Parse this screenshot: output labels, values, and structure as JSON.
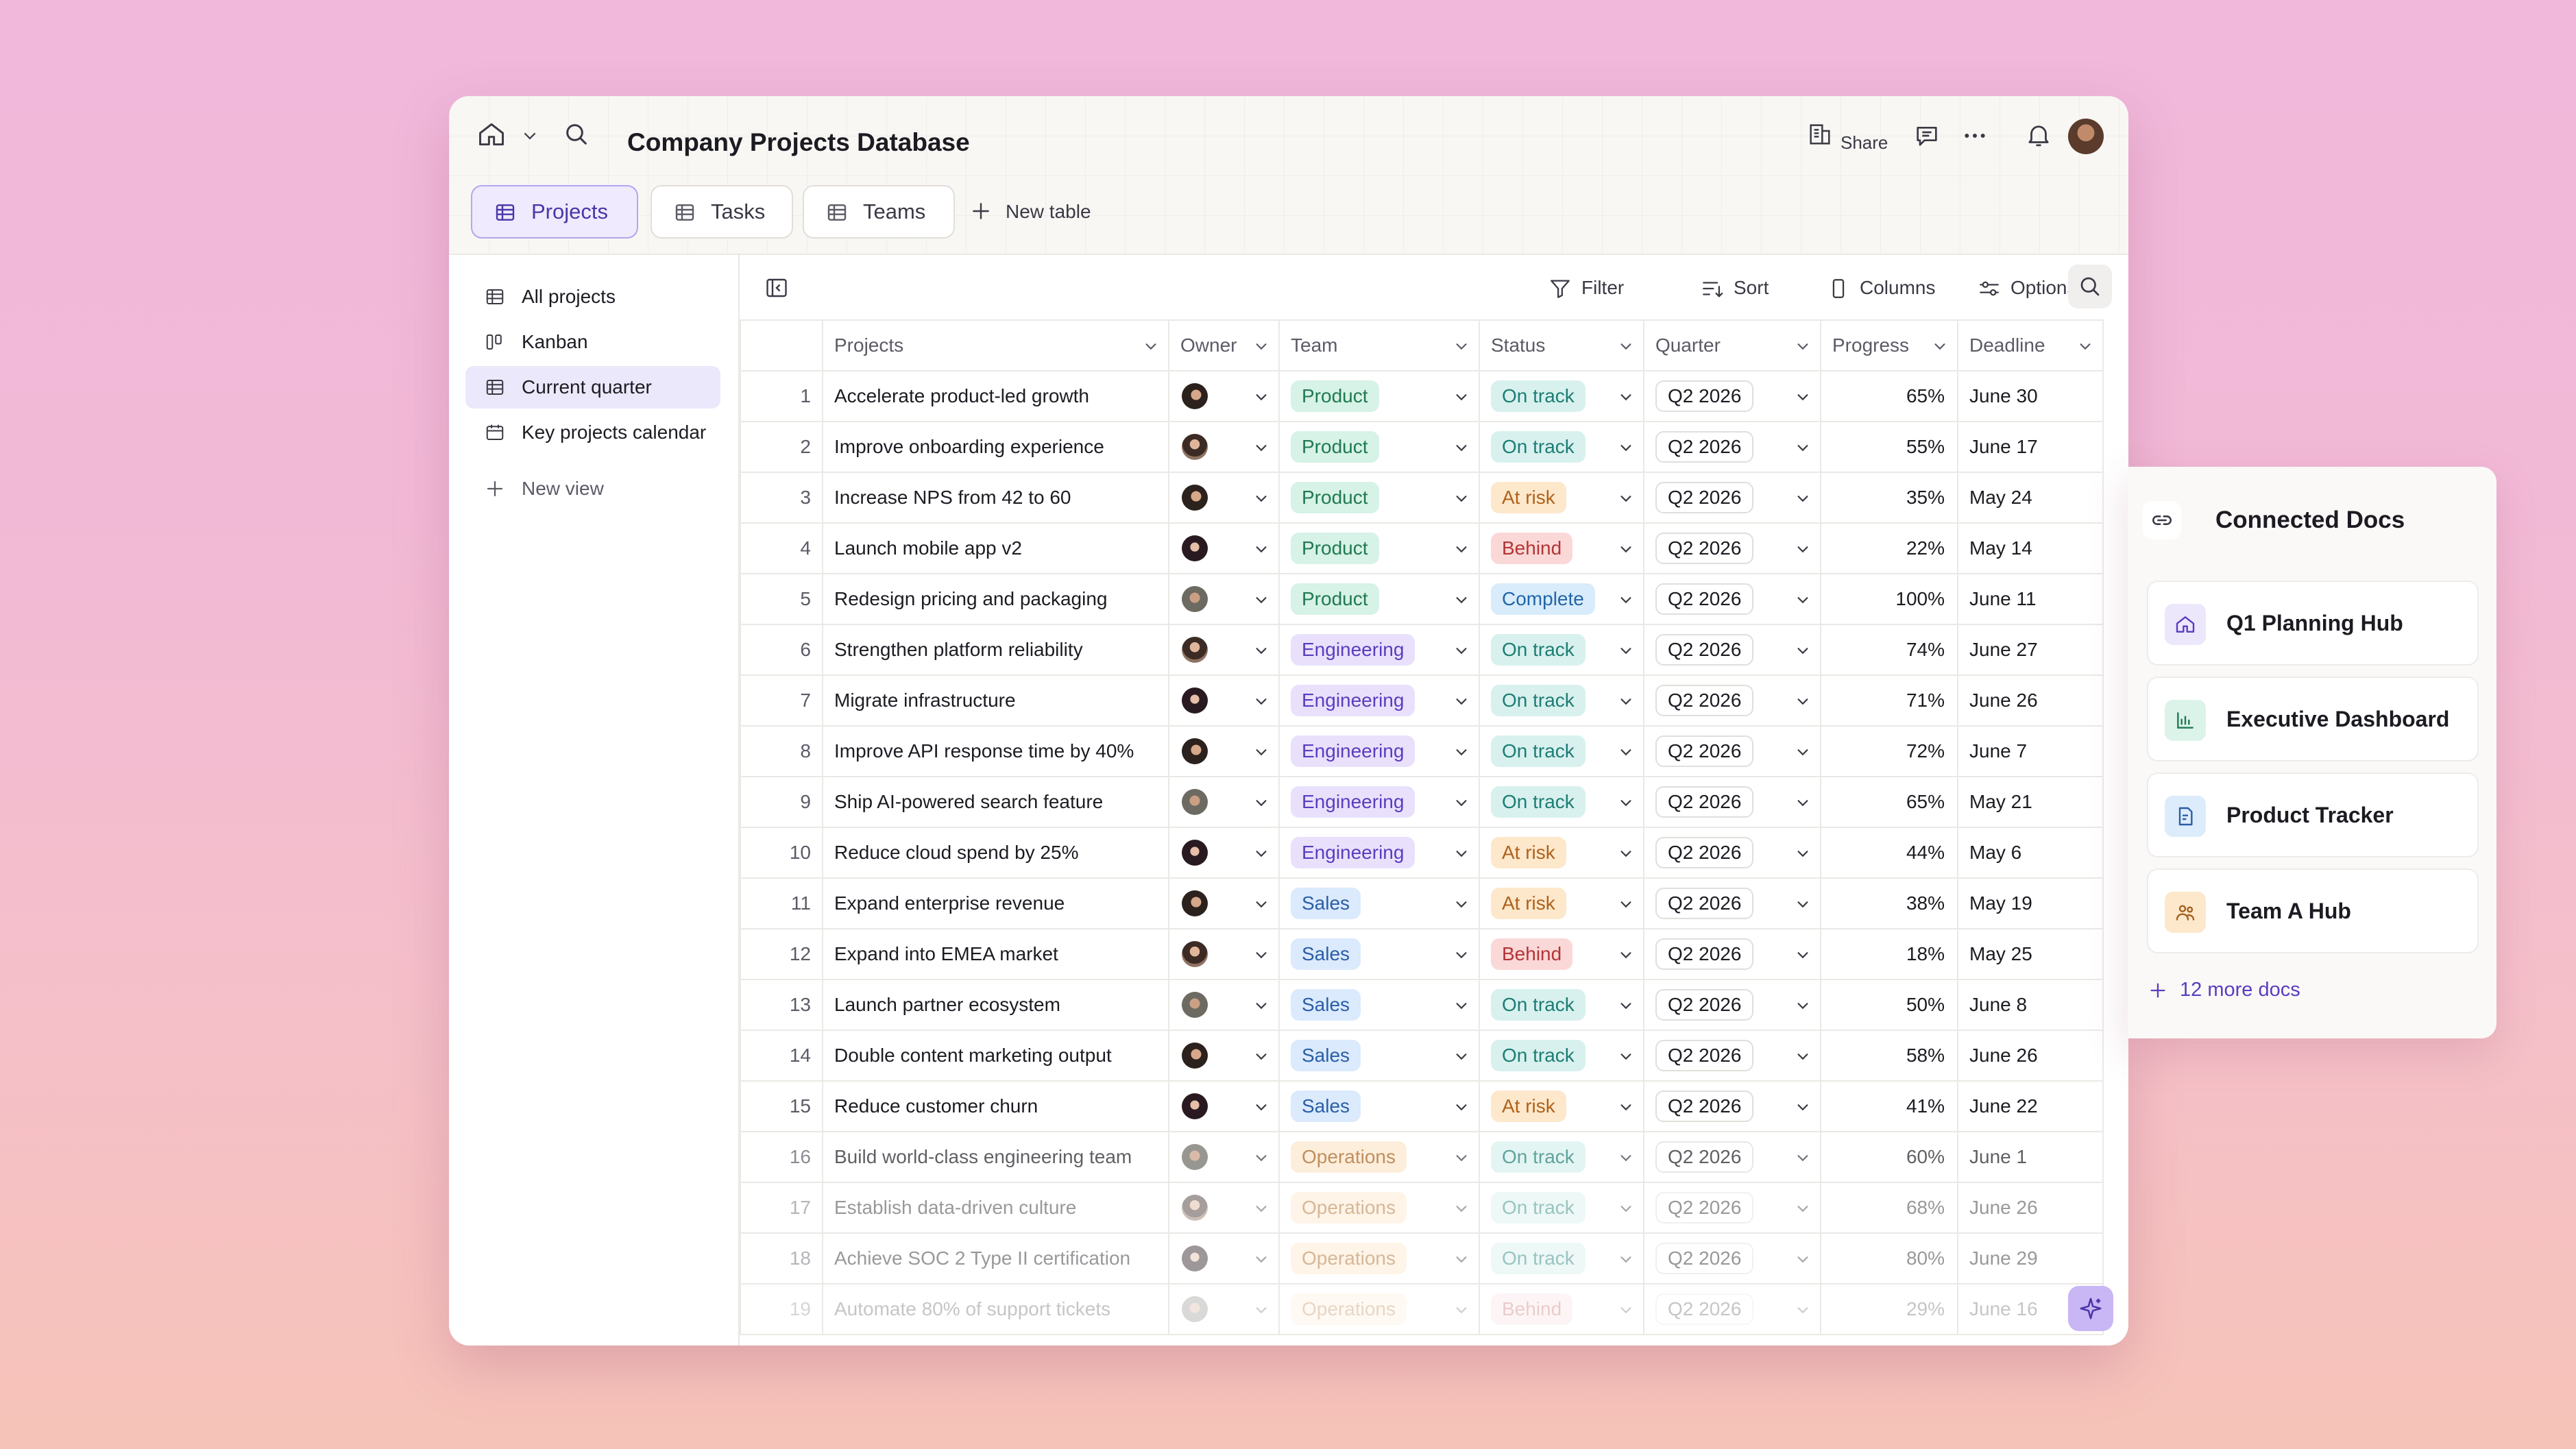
{
  "window": {
    "title": "Company Projects Database",
    "share_label": "Share",
    "icons": [
      "home-icon",
      "chevron-down-icon",
      "search-icon",
      "share-icon",
      "comment-icon",
      "more-icon",
      "bell-icon",
      "avatar"
    ]
  },
  "tabs": [
    {
      "label": "Projects",
      "active": true
    },
    {
      "label": "Tasks",
      "active": false
    },
    {
      "label": "Teams",
      "active": false
    }
  ],
  "new_table_label": "New table",
  "sidebar": {
    "items": [
      {
        "label": "All projects",
        "icon": "table-icon"
      },
      {
        "label": "Kanban",
        "icon": "kanban-icon"
      },
      {
        "label": "Current quarter",
        "icon": "table-icon",
        "active": true
      },
      {
        "label": "Key projects calendar",
        "icon": "calendar-icon"
      }
    ],
    "new_view_label": "New view"
  },
  "toolbar": {
    "filter": "Filter",
    "sort": "Sort",
    "columns": "Columns",
    "options": "Options"
  },
  "table": {
    "columns": [
      "Projects",
      "Owner",
      "Team",
      "Status",
      "Quarter",
      "Progress",
      "Deadline"
    ],
    "rows": [
      {
        "n": "1",
        "project": "Accelerate product-led growth",
        "owner": "av1",
        "team": "Product",
        "status": "On track",
        "quarter": "Q2 2026",
        "progress": "65%",
        "deadline": "June 30"
      },
      {
        "n": "2",
        "project": "Improve onboarding experience",
        "owner": "av2",
        "team": "Product",
        "status": "On track",
        "quarter": "Q2 2026",
        "progress": "55%",
        "deadline": "June 17"
      },
      {
        "n": "3",
        "project": "Increase NPS from 42 to 60",
        "owner": "av1",
        "team": "Product",
        "status": "At risk",
        "quarter": "Q2 2026",
        "progress": "35%",
        "deadline": "May 24"
      },
      {
        "n": "4",
        "project": "Launch mobile app v2",
        "owner": "av3",
        "team": "Product",
        "status": "Behind",
        "quarter": "Q2 2026",
        "progress": "22%",
        "deadline": "May 14"
      },
      {
        "n": "5",
        "project": "Redesign pricing and packaging",
        "owner": "av4",
        "team": "Product",
        "status": "Complete",
        "quarter": "Q2 2026",
        "progress": "100%",
        "deadline": "June 11"
      },
      {
        "n": "6",
        "project": "Strengthen platform reliability",
        "owner": "av2",
        "team": "Engineering",
        "status": "On track",
        "quarter": "Q2 2026",
        "progress": "74%",
        "deadline": "June 27"
      },
      {
        "n": "7",
        "project": "Migrate infrastructure",
        "owner": "av3",
        "team": "Engineering",
        "status": "On track",
        "quarter": "Q2 2026",
        "progress": "71%",
        "deadline": "June 26"
      },
      {
        "n": "8",
        "project": "Improve API response time by 40%",
        "owner": "av1",
        "team": "Engineering",
        "status": "On track",
        "quarter": "Q2 2026",
        "progress": "72%",
        "deadline": "June 7"
      },
      {
        "n": "9",
        "project": "Ship AI-powered search feature",
        "owner": "av4",
        "team": "Engineering",
        "status": "On track",
        "quarter": "Q2 2026",
        "progress": "65%",
        "deadline": "May 21"
      },
      {
        "n": "10",
        "project": "Reduce cloud spend by 25%",
        "owner": "av3",
        "team": "Engineering",
        "status": "At risk",
        "quarter": "Q2 2026",
        "progress": "44%",
        "deadline": "May 6"
      },
      {
        "n": "11",
        "project": "Expand enterprise revenue",
        "owner": "av1",
        "team": "Sales",
        "status": "At risk",
        "quarter": "Q2 2026",
        "progress": "38%",
        "deadline": "May 19"
      },
      {
        "n": "12",
        "project": "Expand into EMEA market",
        "owner": "av2",
        "team": "Sales",
        "status": "Behind",
        "quarter": "Q2 2026",
        "progress": "18%",
        "deadline": "May 25"
      },
      {
        "n": "13",
        "project": "Launch partner ecosystem",
        "owner": "av4",
        "team": "Sales",
        "status": "On track",
        "quarter": "Q2 2026",
        "progress": "50%",
        "deadline": "June 8"
      },
      {
        "n": "14",
        "project": "Double content marketing output",
        "owner": "av1",
        "team": "Sales",
        "status": "On track",
        "quarter": "Q2 2026",
        "progress": "58%",
        "deadline": "June 26"
      },
      {
        "n": "15",
        "project": "Reduce customer churn",
        "owner": "av3",
        "team": "Sales",
        "status": "At risk",
        "quarter": "Q2 2026",
        "progress": "41%",
        "deadline": "June 22"
      },
      {
        "n": "16",
        "project": "Build world-class engineering team",
        "owner": "av4",
        "team": "Operations",
        "status": "On track",
        "quarter": "Q2 2026",
        "progress": "60%",
        "deadline": "June 1"
      },
      {
        "n": "17",
        "project": "Establish data-driven culture",
        "owner": "av2",
        "team": "Operations",
        "status": "On track",
        "quarter": "Q2 2026",
        "progress": "68%",
        "deadline": "June 26"
      },
      {
        "n": "18",
        "project": "Achieve SOC 2 Type II certification",
        "owner": "av3",
        "team": "Operations",
        "status": "On track",
        "quarter": "Q2 2026",
        "progress": "80%",
        "deadline": "June 29"
      },
      {
        "n": "19",
        "project": "Automate 80% of support tickets",
        "owner": "av4",
        "team": "Operations",
        "status": "Behind",
        "quarter": "Q2 2026",
        "progress": "29%",
        "deadline": "June 16"
      }
    ]
  },
  "connected_docs": {
    "title": "Connected Docs",
    "items": [
      {
        "label": "Q1 Planning Hub",
        "icon": "home-icon",
        "color": "#ece7fb"
      },
      {
        "label": "Executive Dashboard",
        "icon": "chart-icon",
        "color": "#dcf3ea"
      },
      {
        "label": "Product Tracker",
        "icon": "document-icon",
        "color": "#ddecfb"
      },
      {
        "label": "Team A Hub",
        "icon": "people-icon",
        "color": "#fde8cc"
      }
    ],
    "more_label": "12 more docs"
  },
  "colors": {
    "accent": "#5b3cbf",
    "tab_active_bg": "#efeafd",
    "background_top": "#f1b8dc",
    "background_bottom": "#f6c3b8"
  }
}
